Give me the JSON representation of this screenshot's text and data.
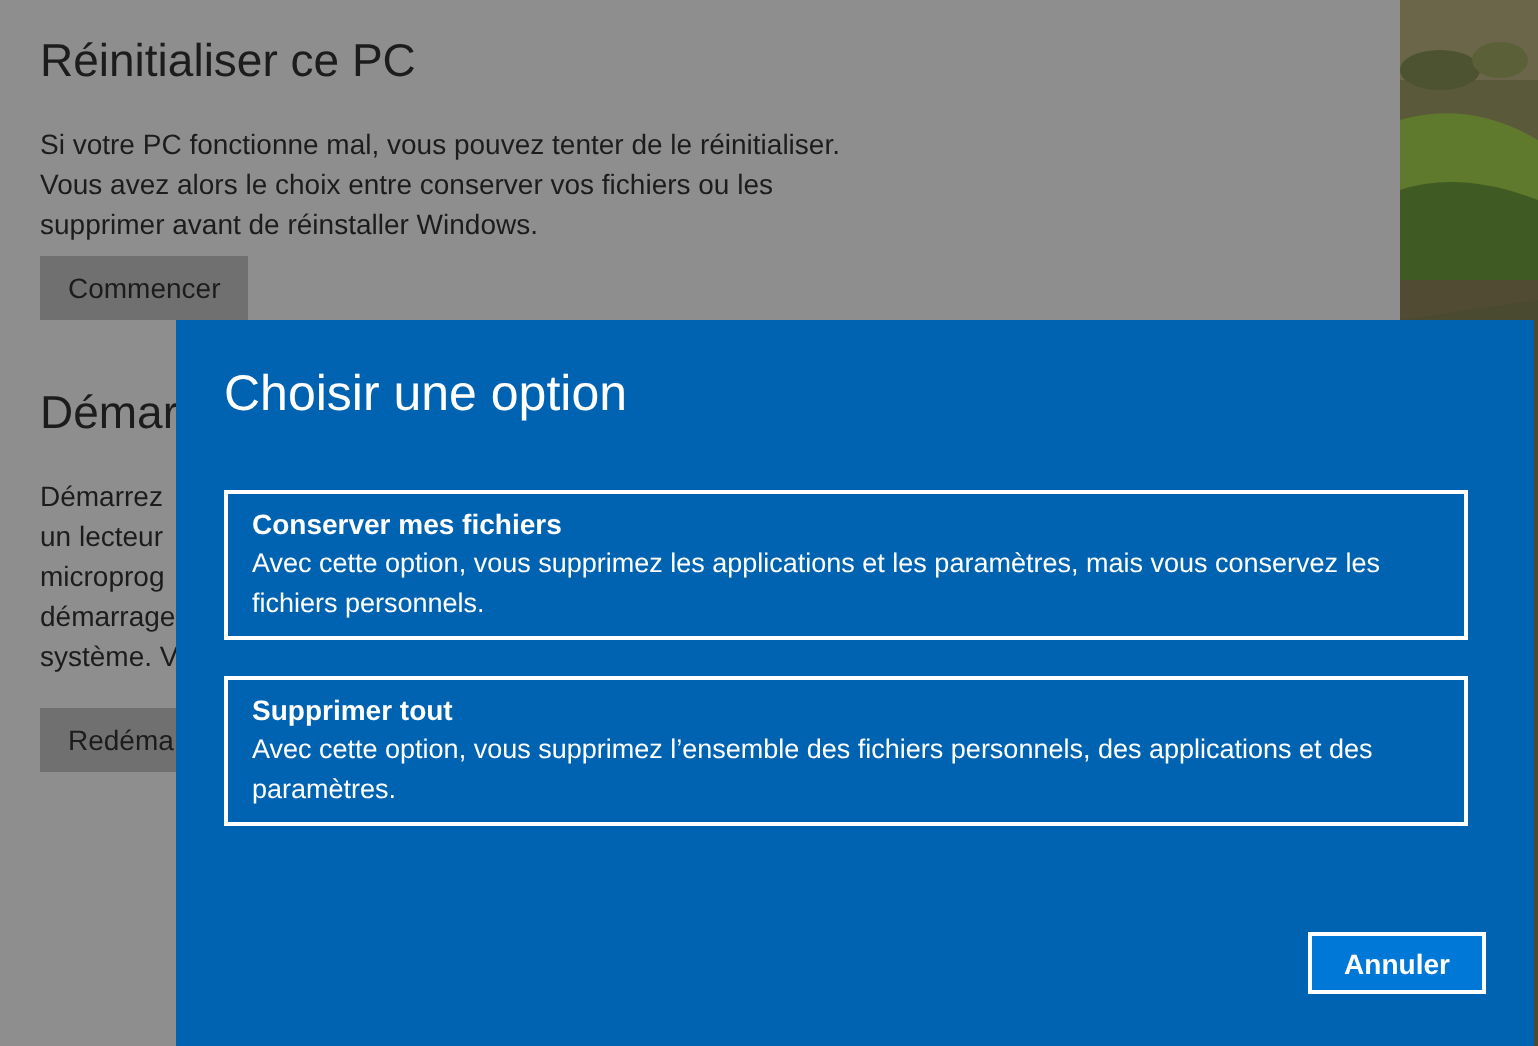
{
  "settings": {
    "sections": [
      {
        "title": "Réinitialiser ce PC",
        "lines": [
          "Si votre PC fonctionne mal, vous pouvez tenter de le réinitialiser.",
          "Vous avez alors le choix entre conserver vos fichiers ou les",
          "supprimer avant de réinstaller Windows."
        ],
        "button": "Commencer"
      },
      {
        "title": "Démar",
        "lines": [
          "Démarrez",
          "un lecteur",
          "microprog",
          "démarrage",
          "système. V"
        ],
        "button": "Redéma"
      }
    ]
  },
  "dialog": {
    "title": "Choisir une option",
    "options": [
      {
        "title": "Conserver mes fichiers",
        "description": "Avec cette option, vous supprimez les applications et les paramètres, mais vous conservez les fichiers personnels."
      },
      {
        "title": "Supprimer tout",
        "description": "Avec cette option, vous supprimez l’ensemble des fichiers personnels, des applications et des paramètres."
      }
    ],
    "cancel": "Annuler"
  }
}
